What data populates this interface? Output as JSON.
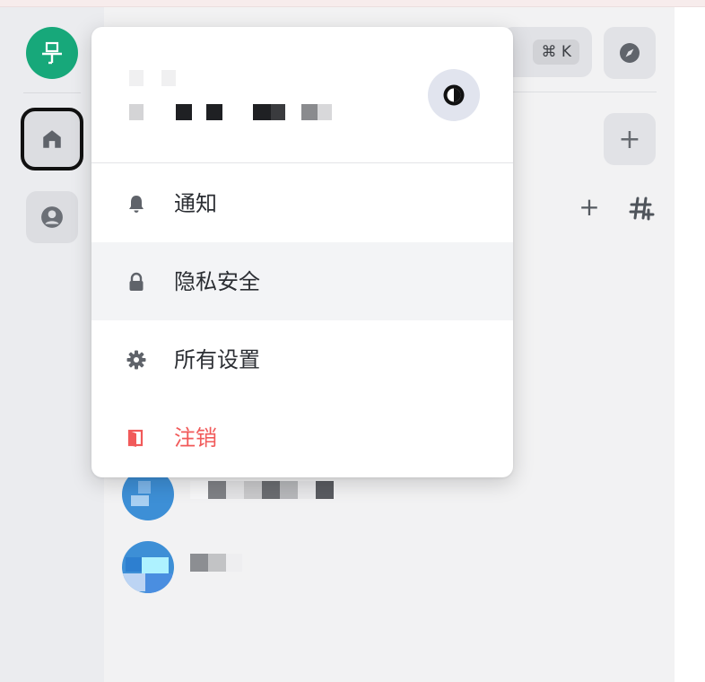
{
  "window": {
    "strip_color": "#f7ecec"
  },
  "rail": {
    "avatar_color": "#17a87a",
    "home_label": "home",
    "user_label": "user"
  },
  "header": {
    "shortcut": "⌘ K"
  },
  "actions": {
    "plus_big": "+",
    "plus_small": "+"
  },
  "menu": {
    "items": [
      {
        "label": "通知",
        "icon": "bell-icon"
      },
      {
        "label": "隐私安全",
        "icon": "lock-icon"
      },
      {
        "label": "所有设置",
        "icon": "gear-icon"
      },
      {
        "label": "注销",
        "icon": "logout-icon",
        "danger_color": "#f15a5a"
      }
    ]
  },
  "colors": {
    "accent": "#17a87a",
    "danger": "#f15a5a",
    "room_avatar": "#3d8fd6"
  }
}
